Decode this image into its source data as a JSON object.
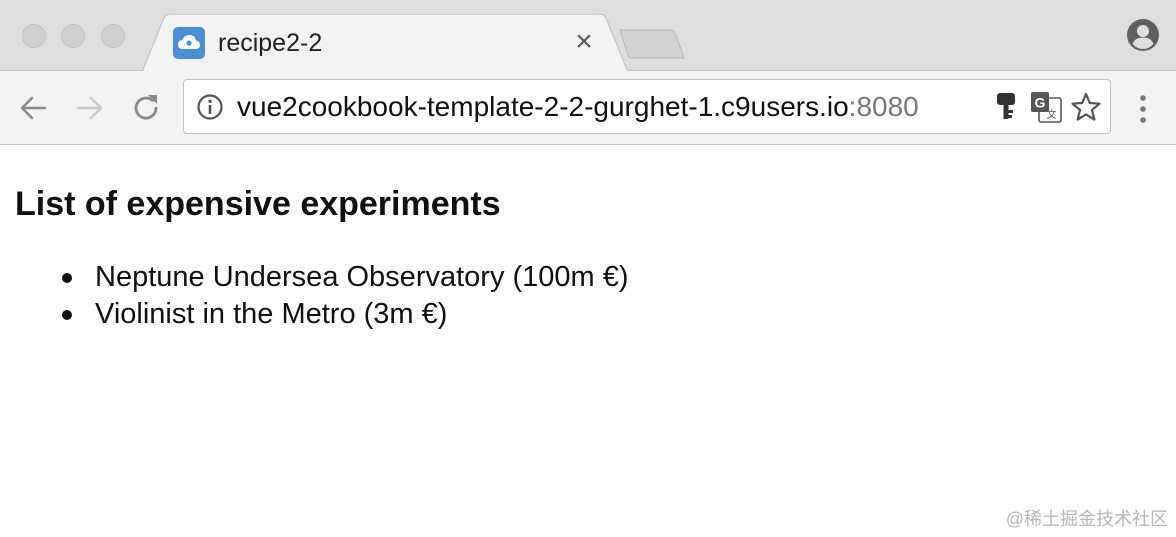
{
  "browser": {
    "tab": {
      "title": "recipe2-2",
      "close_glyph": "×",
      "favicon": "cloud-icon"
    },
    "address_bar": {
      "url_host": "vue2cookbook-template-2-2-gurghet-1.c9users.io",
      "url_port": ":8080"
    },
    "toolbar_icons": [
      "back-icon",
      "forward-icon",
      "reload-icon",
      "info-icon",
      "key-icon",
      "translate-icon",
      "star-icon",
      "menu-icon",
      "profile-icon"
    ]
  },
  "page": {
    "heading": "List of expensive experiments",
    "experiments": [
      {
        "label": "Neptune Undersea Observatory (100m €)"
      },
      {
        "label": "Violinist in the Metro (3m €)"
      }
    ]
  },
  "watermark": "@稀土掘金技术社区",
  "colors": {
    "tabstrip_bg": "#dedede",
    "toolbar_bg": "#f2f2f2",
    "favicon_bg": "#4a90d9",
    "port_text": "#777777"
  }
}
